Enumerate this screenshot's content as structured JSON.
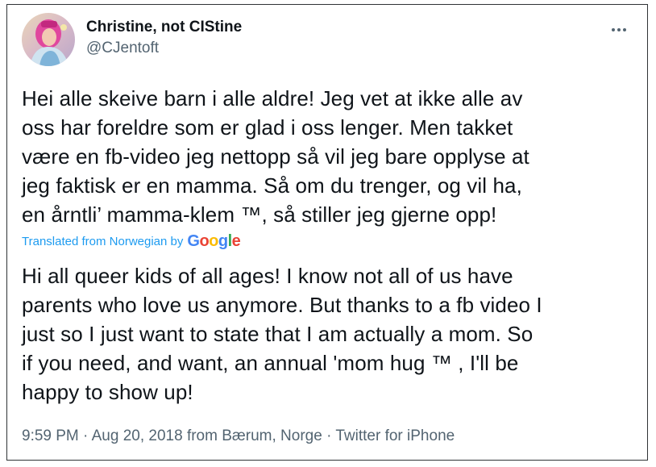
{
  "author": {
    "display_name": "Christine, not CIStine",
    "handle": "@CJentoft"
  },
  "tweet": {
    "original_text": "Hei alle skeive barn i alle aldre! Jeg vet at ikke alle av\noss har foreldre som er glad i oss lenger. Men takket\nvære en fb-video jeg nettopp så vil jeg bare opplyse at\njeg faktisk er en mamma. Så om du trenger, og vil ha,\nen årntli’ mamma-klem ™, så stiller jeg gjerne opp!",
    "translated_from_label": "Translated from Norwegian by",
    "translation_provider": "Google",
    "translated_text": "Hi all queer kids of all ages! I know not all of us have\nparents who love us anymore. But thanks to a fb video I\njust so I just want to state that I am actually a mom. So\nif you need, and want, an annual 'mom hug ™ , I'll be\nhappy to show up!"
  },
  "meta": {
    "time": "9:59 PM",
    "separator": "·",
    "date": "Aug 20, 2018",
    "location": "from Bærum, Norge",
    "source": "Twitter for iPhone"
  },
  "colors": {
    "link_blue": "#1d9bf0",
    "secondary_text": "#536471",
    "google_blue": "#4285F4",
    "google_red": "#EA4335",
    "google_yellow": "#FBBC05",
    "google_green": "#34A853"
  },
  "icons": {
    "more": "more-horizontal-icon"
  }
}
